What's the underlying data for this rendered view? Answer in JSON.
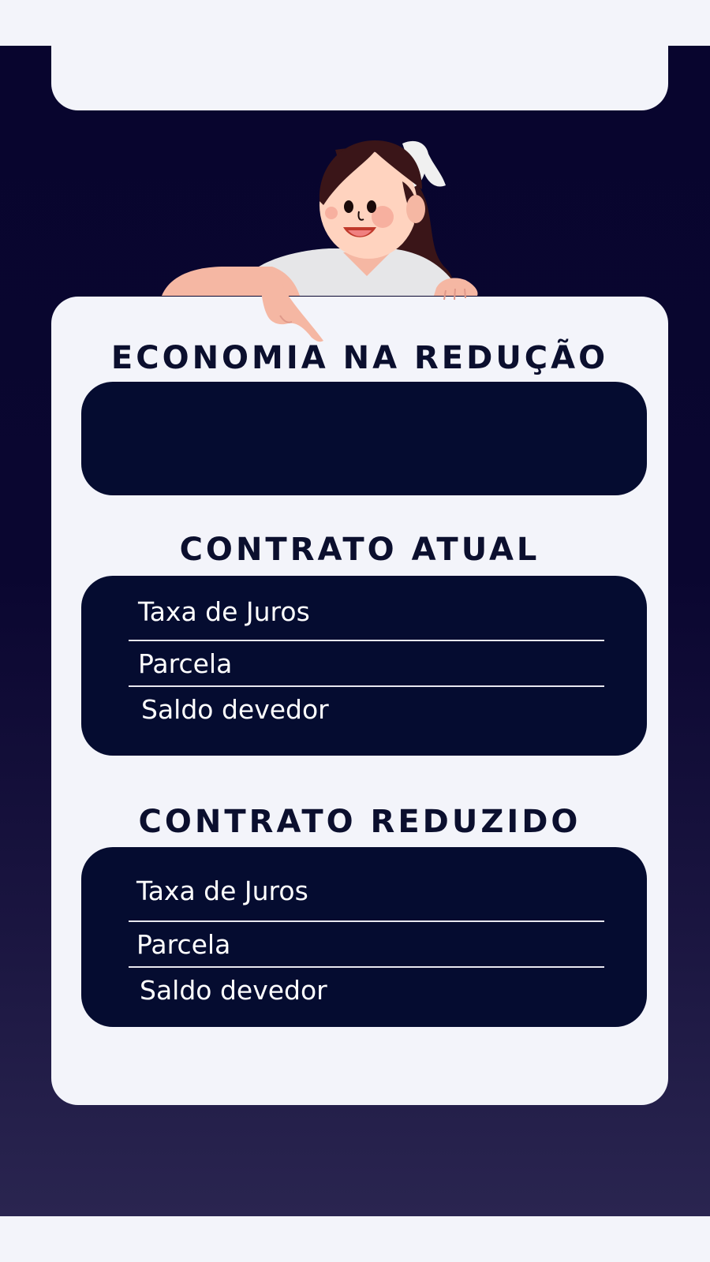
{
  "economy": {
    "title": "ECONOMIA NA REDUÇÃO",
    "value": ""
  },
  "current_contract": {
    "title": "CONTRATO ATUAL",
    "rows": [
      {
        "label": "Taxa de Juros"
      },
      {
        "label": "Parcela"
      },
      {
        "label": "Saldo devedor"
      }
    ]
  },
  "reduced_contract": {
    "title": "CONTRATO REDUZIDO",
    "rows": [
      {
        "label": "Taxa de Juros"
      },
      {
        "label": "Parcela"
      },
      {
        "label": "Saldo devedor"
      }
    ]
  },
  "colors": {
    "background_dark": "#08052e",
    "card": "#f3f4fa",
    "panel": "#050c30",
    "heading_text": "#0b0f2e"
  },
  "illustration": {
    "icon": "woman-pointing-illustration"
  }
}
